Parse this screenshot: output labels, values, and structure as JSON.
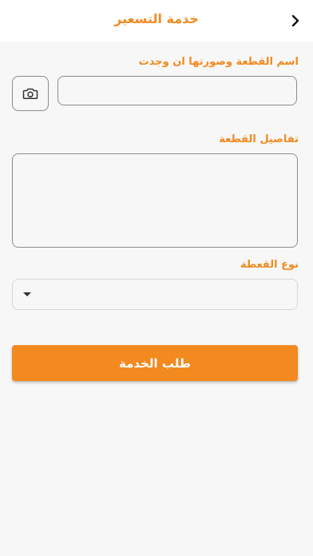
{
  "header": {
    "title": "خدمة التسعير",
    "back_icon": "chevron-right-icon"
  },
  "form": {
    "part_name_label": "اسم القطعة وصورتها ان وجدت",
    "part_name_value": "",
    "camera_icon": "camera-icon",
    "details_label": "تفاصيل القطعة",
    "details_value": "",
    "part_type_label": "نوع القعطة",
    "part_type_selected": "",
    "submit_label": "طلب الخدمة"
  },
  "colors": {
    "accent": "#f28a20",
    "background": "#f7f7f7",
    "header_bg": "#ffffff",
    "border": "#8c8c8c"
  }
}
